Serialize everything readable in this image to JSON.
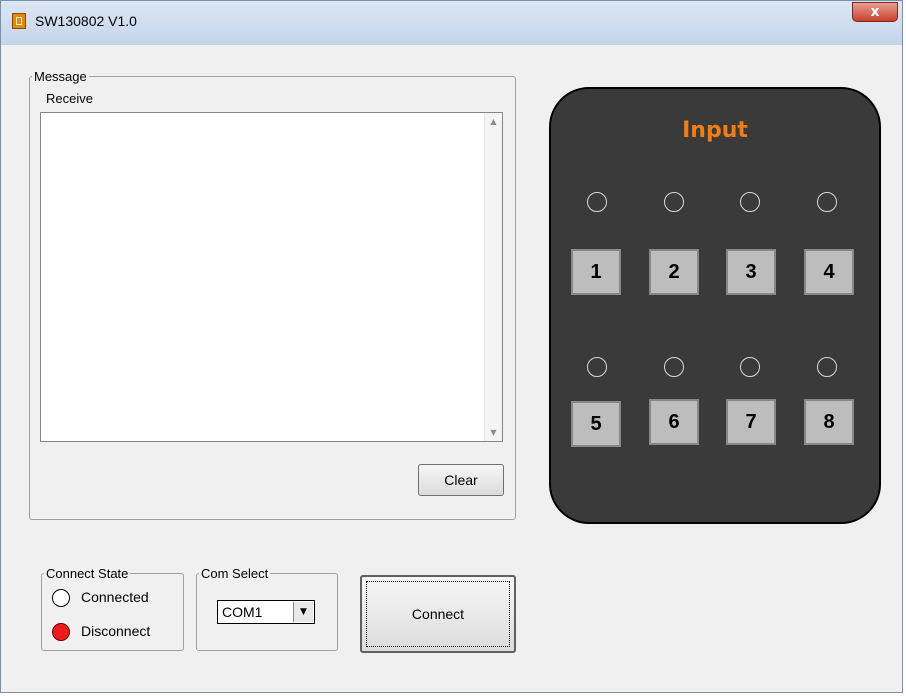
{
  "window": {
    "title": "SW130802 V1.0",
    "close_glyph": "x"
  },
  "message": {
    "group_label": "Message",
    "receive_label": "Receive",
    "receive_text": "",
    "clear_label": "Clear"
  },
  "input_panel": {
    "title": "Input",
    "buttons": [
      "1",
      "2",
      "3",
      "4",
      "5",
      "6",
      "7",
      "8"
    ]
  },
  "connect_state": {
    "group_label": "Connect State",
    "connected_label": "Connected",
    "disconnect_label": "Disconnect",
    "current": "Disconnect"
  },
  "com_select": {
    "group_label": "Com Select",
    "value": "COM1"
  },
  "connect_button": {
    "label": "Connect"
  },
  "colors": {
    "title_accent": "#f07e10",
    "panel_bg": "#3a3a3a",
    "disconnect_indicator": "#ee1c1c"
  }
}
